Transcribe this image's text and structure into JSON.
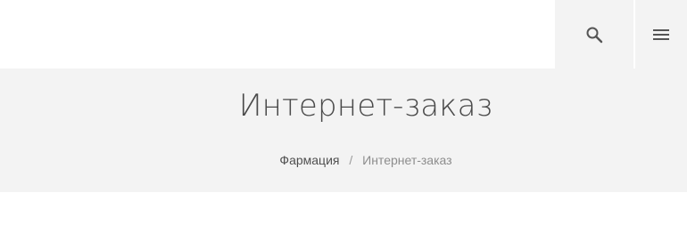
{
  "header": {
    "search_icon": "search-icon",
    "menu_icon": "hamburger-menu-icon"
  },
  "title_band": {
    "title": "Интернет-заказ",
    "breadcrumb": {
      "parent": "Фармация",
      "separator": "/",
      "current": "Интернет-заказ"
    }
  },
  "colors": {
    "band_background": "#f3f3f3",
    "title_text": "#4a4a4a",
    "breadcrumb_link": "#4f4f4f",
    "breadcrumb_current": "#8d8d8d"
  }
}
